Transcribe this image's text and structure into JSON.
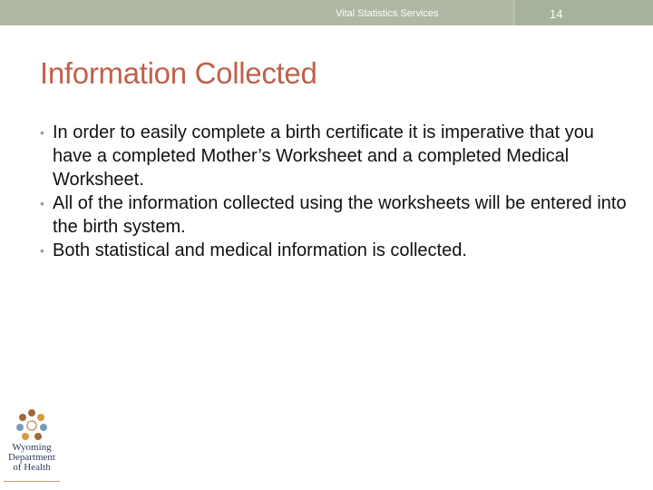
{
  "header": {
    "title": "Vital Statistics Services",
    "slide_number": "14"
  },
  "slide": {
    "title": "Information Collected",
    "bullets": [
      "In order to easily complete a birth certificate it is imperative that you have a completed Mother’s Worksheet and a completed Medical Worksheet.",
      "All of the information collected using the worksheets will be entered into the birth system.",
      "Both statistical and medical information is collected."
    ]
  },
  "logo": {
    "lines": [
      "Wyoming",
      "Department",
      "of Health"
    ],
    "icon": "wyoming-department-of-health-logo"
  },
  "colors": {
    "title": "#c0614b",
    "header_bar": "#aeb8a4",
    "bullet": "#9aa28e"
  }
}
